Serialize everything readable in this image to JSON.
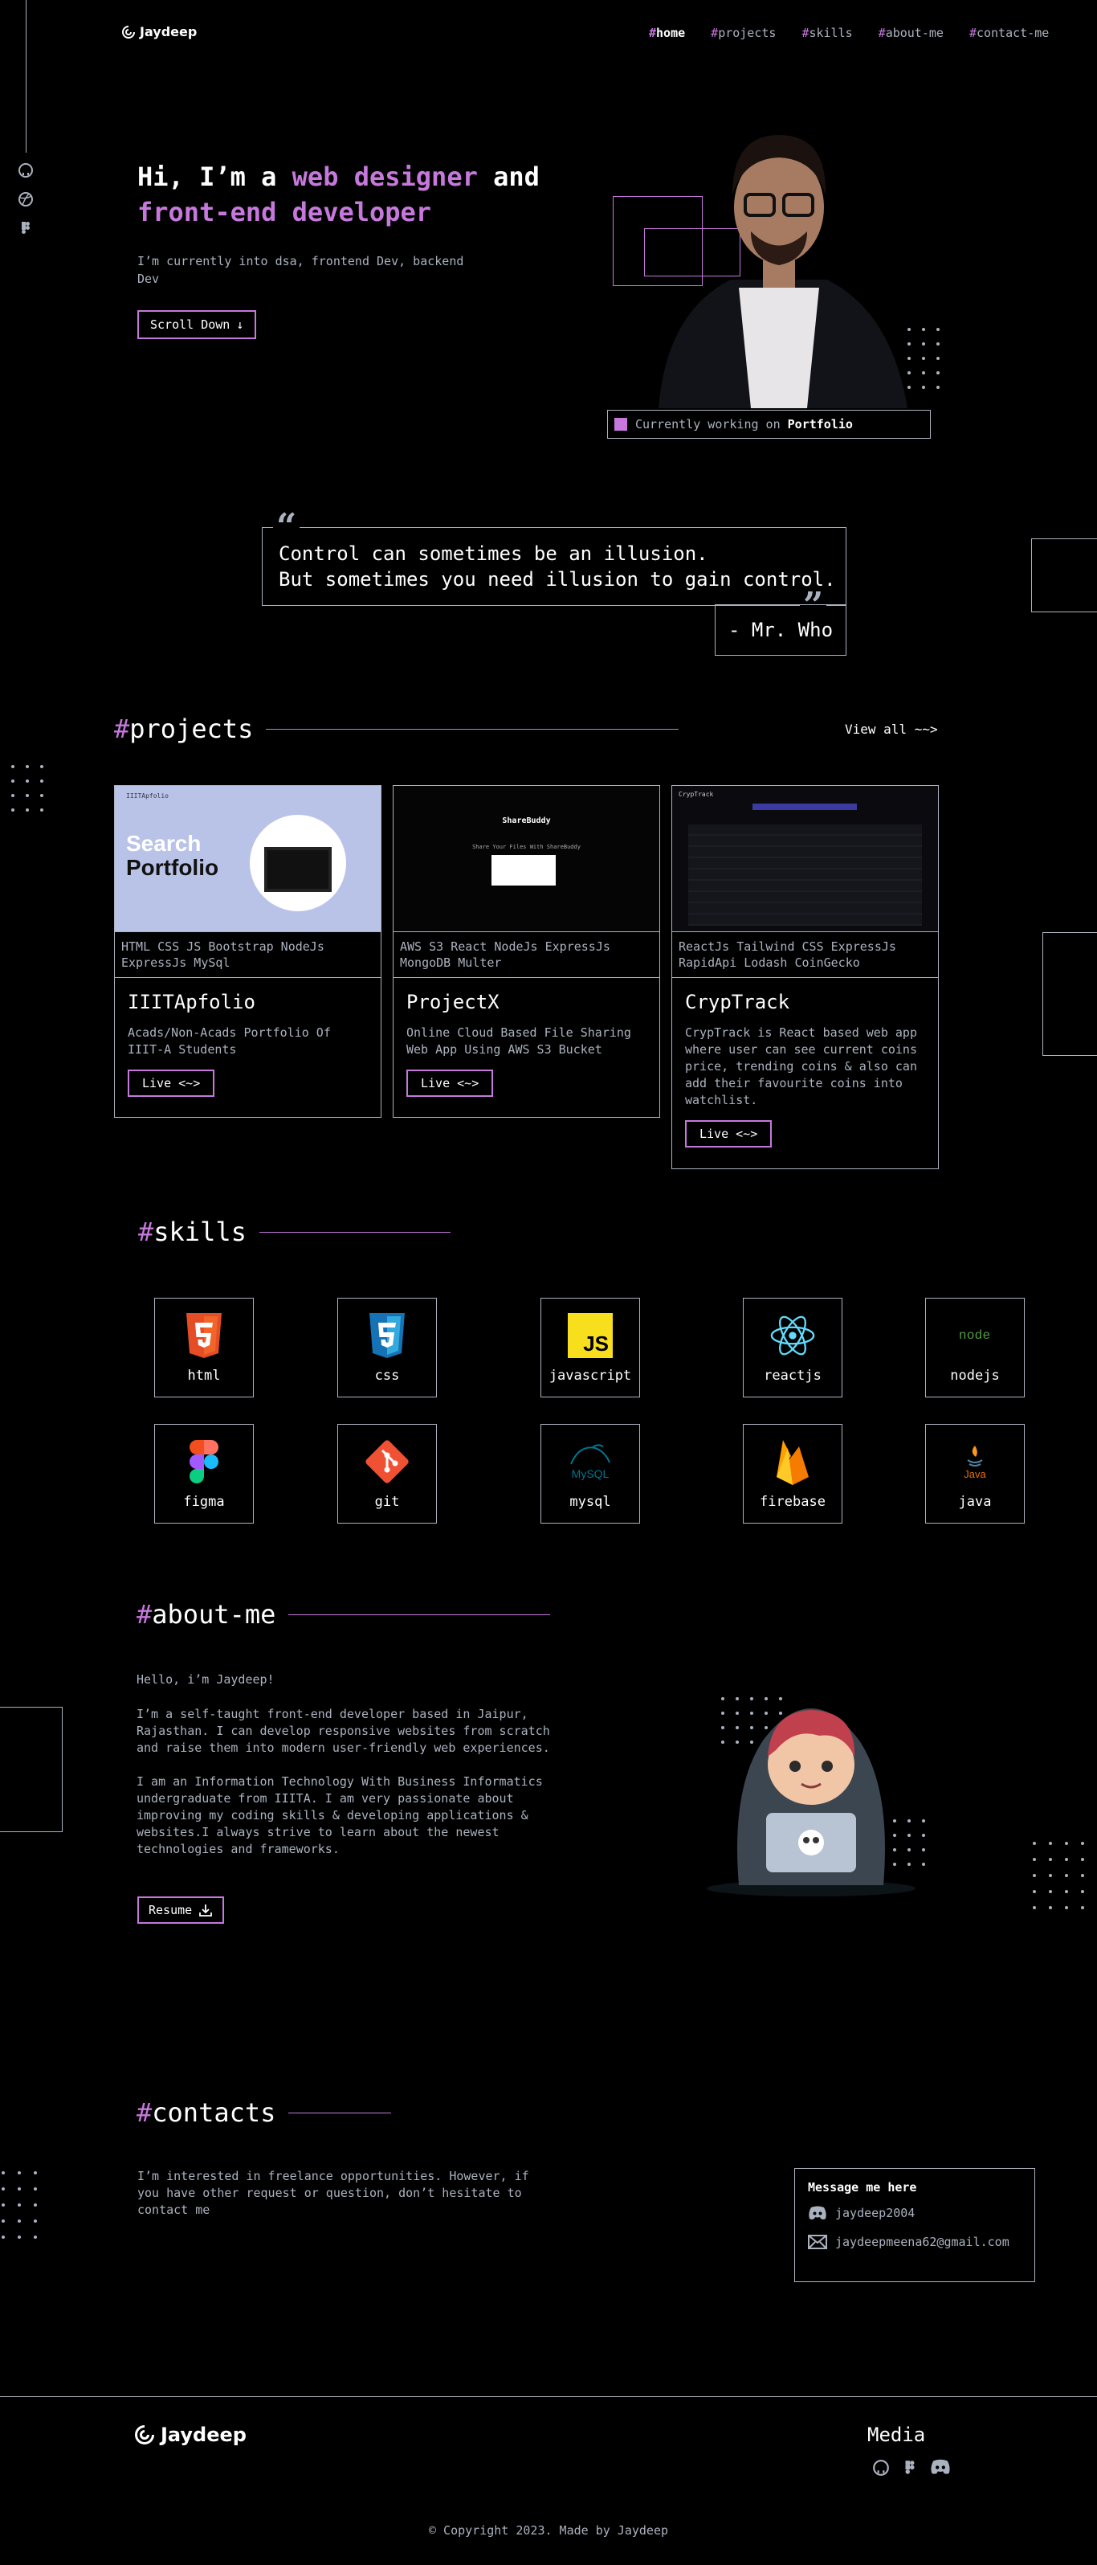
{
  "header": {
    "logo": "Jaydeep",
    "nav": [
      {
        "hash": "#",
        "label": "home"
      },
      {
        "hash": "#",
        "label": "projects"
      },
      {
        "hash": "#",
        "label": "skills"
      },
      {
        "hash": "#",
        "label": "about-me"
      },
      {
        "hash": "#",
        "label": "contact-me"
      }
    ]
  },
  "hero": {
    "line1_pre": "Hi, I’m a ",
    "line1_accent": "web designer",
    "line1_post": " and",
    "line2_accent": "front-end developer",
    "subtitle": "I’m currently into dsa, frontend Dev, backend Dev",
    "button": "Scroll Down",
    "status_prefix": "Currently working on ",
    "status_project": "Portfolio"
  },
  "quote": {
    "line1": "Control can sometimes be an illusion.",
    "line2": "But sometimes you need illusion to gain control.",
    "author": "- Mr. Who"
  },
  "projects": {
    "hash": "#",
    "title": "projects",
    "view_all": "View all ~~>",
    "items": [
      {
        "tech": "HTML CSS JS Bootstrap NodeJs ExpressJs MySql",
        "name": "IIITApfolio",
        "desc": "Acads/Non-Acads Portfolio Of IIIT-A Students",
        "button": "Live <~>",
        "shot_title": "Search",
        "shot_sub": "Portfolio"
      },
      {
        "tech": "AWS S3 React NodeJs ExpressJs MongoDB Multer",
        "name": "ProjectX",
        "desc": "Online Cloud Based File Sharing Web App Using AWS S3 Bucket",
        "button": "Live <~>",
        "shot_title": "ShareBuddy",
        "shot_sub": "Share Your Files With ShareBuddy"
      },
      {
        "tech": "ReactJs Tailwind CSS ExpressJs RapidApi Lodash CoinGecko",
        "name": "CrypTrack",
        "desc": "CrypTrack is React based web app where user can see current coins price, trending coins & also can add their favourite coins into watchlist.",
        "button": "Live <~>",
        "shot_title": "CrypTrack",
        "shot_sub": ""
      }
    ]
  },
  "skills": {
    "hash": "#",
    "title": "skills",
    "items": [
      {
        "label": "html",
        "icon": "html5-icon"
      },
      {
        "label": "css",
        "icon": "css3-icon"
      },
      {
        "label": "javascript",
        "icon": "javascript-icon"
      },
      {
        "label": "reactjs",
        "icon": "react-icon"
      },
      {
        "label": "nodejs",
        "icon": "nodejs-icon"
      },
      {
        "label": "figma",
        "icon": "figma-icon"
      },
      {
        "label": "git",
        "icon": "git-icon"
      },
      {
        "label": "mysql",
        "icon": "mysql-icon"
      },
      {
        "label": "firebase",
        "icon": "firebase-icon"
      },
      {
        "label": "java",
        "icon": "java-icon"
      }
    ],
    "icon_text": {
      "js": "JS",
      "nodejs": "node",
      "mysql": "MySQL",
      "java": "Java"
    }
  },
  "about": {
    "hash": "#",
    "title": "about-me",
    "greeting": "Hello, i’m Jaydeep!",
    "para1": "I’m a self-taught front-end developer based in Jaipur, Rajasthan. I can develop responsive websites from scratch and raise them into modern user-friendly web experiences.",
    "para2": "I am an Information Technology With Business Informatics undergraduate from IIITA. I am very passionate about improving my coding skills & developing applications & websites.I always strive to learn about the newest technologies and frameworks.",
    "button": "Resume"
  },
  "contacts": {
    "hash": "#",
    "title": "contacts",
    "text": "I’m interested in freelance opportunities. However, if you have other request or question, don’t hesitate to contact me",
    "box_title": "Message me here",
    "discord": "jaydeep2004",
    "email": "jaydeepmeena62@gmail.com"
  },
  "footer": {
    "logo": "Jaydeep",
    "media": "Media",
    "copyright": "© Copyright 2023. Made by Jaydeep"
  },
  "colors": {
    "accent": "#c778dd",
    "gray": "#abb2bf",
    "background": "#000000"
  }
}
